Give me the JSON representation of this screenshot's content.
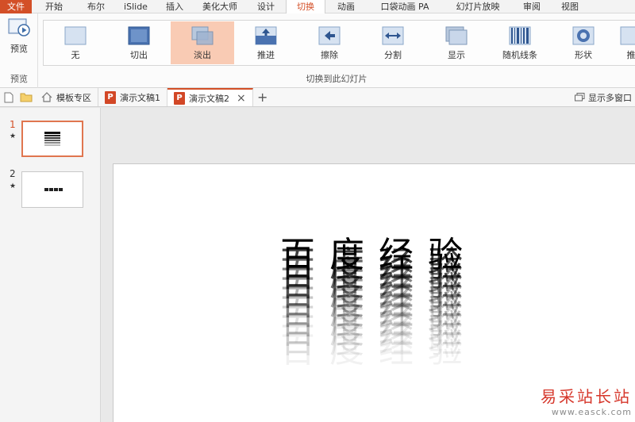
{
  "menubar": {
    "file": "文件",
    "items": [
      "开始",
      "布尔",
      "iSlide",
      "插入",
      "美化大师",
      "设计",
      "切换",
      "动画",
      "口袋动画 PA",
      "幻灯片放映",
      "审阅",
      "视图"
    ],
    "active_index": 6
  },
  "ribbon": {
    "preview_label": "预览",
    "preview_group_label": "预览",
    "transitions": [
      "无",
      "切出",
      "淡出",
      "推进",
      "擦除",
      "分割",
      "显示",
      "随机线条",
      "形状",
      "推"
    ],
    "selected_index": 2,
    "group_caption": "切换到此幻灯片"
  },
  "tabs": {
    "template_zone": "模板专区",
    "doc1": "演示文稿1",
    "doc2": "演示文稿2",
    "ppt_badge": "P",
    "add": "+",
    "close": "×",
    "show_multi_window": "显示多窗口"
  },
  "thumbnails": [
    {
      "number": "1",
      "star": "★"
    },
    {
      "number": "2",
      "star": "★"
    }
  ],
  "slide": {
    "text": "百度经验"
  },
  "watermark": {
    "cn": "易采站长站",
    "url": "www.easck.com"
  },
  "colors": {
    "accent": "#d34f27",
    "selected_transition": "#f9cbb4"
  }
}
